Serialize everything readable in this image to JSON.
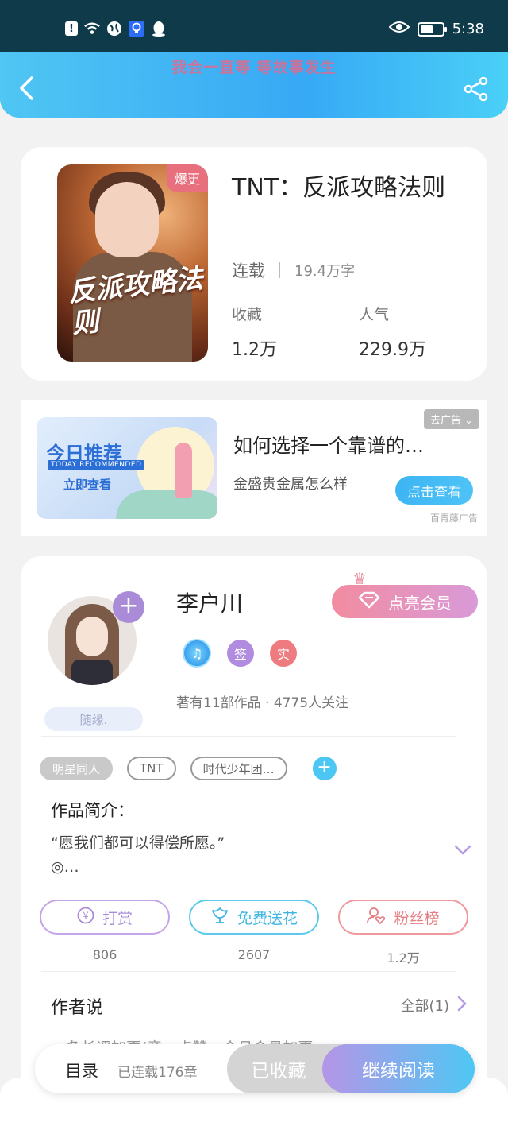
{
  "status_bar": {
    "time": "5:38"
  },
  "header": {
    "title": "我会一直等 等故事发生"
  },
  "book": {
    "badge": "爆更",
    "cover_title": "反派攻略法则",
    "title": "TNT：反派攻略法则",
    "status": "连载",
    "words": "19.4万字",
    "favorites_label": "收藏",
    "favorites_value": "1.2万",
    "popularity_label": "人气",
    "popularity_value": "229.9万"
  },
  "ad": {
    "image_title": "今日推荐",
    "image_subtitle": "TODAY RECOMMENDED",
    "image_cta": "立即查看",
    "title": "如何选择一个靠谱的…",
    "description": "金盛贵金属怎么样",
    "remove_label": "去广告",
    "button_label": "点击查看",
    "source": "百青藤广告"
  },
  "author": {
    "name": "李户川",
    "signature": "随缘.",
    "vip_label": "点亮会员",
    "badge_sign": "签",
    "badge_real": "实",
    "stats": "著有11部作品 · 4775人关注",
    "tags": [
      "明星同人",
      "TNT",
      "时代少年团…"
    ],
    "intro_title": "作品简介：",
    "intro_line1": "“愿我们都可以得偿所愿。”",
    "intro_line2": "◎…",
    "actions": [
      {
        "label": "打赏",
        "count": "806"
      },
      {
        "label": "免费送花",
        "count": "2607"
      },
      {
        "label": "粉丝榜",
        "count": "1.2万"
      }
    ],
    "says_title": "作者说",
    "says_all": "全部(1)",
    "says_preview": "一条长评加更(章一点赞一个月会员加更"
  },
  "bottom": {
    "toc_label": "目录",
    "toc_count": "已连载176章",
    "collected_label": "已收藏",
    "continue_label": "继续阅读"
  },
  "colors": {
    "header_blue": "#37a9f5",
    "accent_purple": "#a98bd8",
    "accent_cyan": "#4ec7f4",
    "accent_pink": "#f28ca0"
  }
}
